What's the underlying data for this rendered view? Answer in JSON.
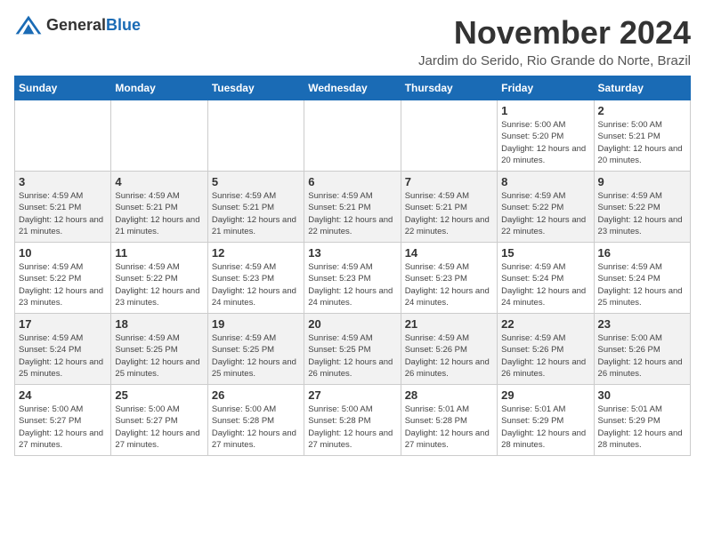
{
  "logo": {
    "general": "General",
    "blue": "Blue"
  },
  "header": {
    "title": "November 2024",
    "subtitle": "Jardim do Serido, Rio Grande do Norte, Brazil"
  },
  "calendar": {
    "weekdays": [
      "Sunday",
      "Monday",
      "Tuesday",
      "Wednesday",
      "Thursday",
      "Friday",
      "Saturday"
    ],
    "weeks": [
      [
        {
          "day": "",
          "info": ""
        },
        {
          "day": "",
          "info": ""
        },
        {
          "day": "",
          "info": ""
        },
        {
          "day": "",
          "info": ""
        },
        {
          "day": "",
          "info": ""
        },
        {
          "day": "1",
          "info": "Sunrise: 5:00 AM\nSunset: 5:20 PM\nDaylight: 12 hours and 20 minutes."
        },
        {
          "day": "2",
          "info": "Sunrise: 5:00 AM\nSunset: 5:21 PM\nDaylight: 12 hours and 20 minutes."
        }
      ],
      [
        {
          "day": "3",
          "info": "Sunrise: 4:59 AM\nSunset: 5:21 PM\nDaylight: 12 hours and 21 minutes."
        },
        {
          "day": "4",
          "info": "Sunrise: 4:59 AM\nSunset: 5:21 PM\nDaylight: 12 hours and 21 minutes."
        },
        {
          "day": "5",
          "info": "Sunrise: 4:59 AM\nSunset: 5:21 PM\nDaylight: 12 hours and 21 minutes."
        },
        {
          "day": "6",
          "info": "Sunrise: 4:59 AM\nSunset: 5:21 PM\nDaylight: 12 hours and 22 minutes."
        },
        {
          "day": "7",
          "info": "Sunrise: 4:59 AM\nSunset: 5:21 PM\nDaylight: 12 hours and 22 minutes."
        },
        {
          "day": "8",
          "info": "Sunrise: 4:59 AM\nSunset: 5:22 PM\nDaylight: 12 hours and 22 minutes."
        },
        {
          "day": "9",
          "info": "Sunrise: 4:59 AM\nSunset: 5:22 PM\nDaylight: 12 hours and 23 minutes."
        }
      ],
      [
        {
          "day": "10",
          "info": "Sunrise: 4:59 AM\nSunset: 5:22 PM\nDaylight: 12 hours and 23 minutes."
        },
        {
          "day": "11",
          "info": "Sunrise: 4:59 AM\nSunset: 5:22 PM\nDaylight: 12 hours and 23 minutes."
        },
        {
          "day": "12",
          "info": "Sunrise: 4:59 AM\nSunset: 5:23 PM\nDaylight: 12 hours and 24 minutes."
        },
        {
          "day": "13",
          "info": "Sunrise: 4:59 AM\nSunset: 5:23 PM\nDaylight: 12 hours and 24 minutes."
        },
        {
          "day": "14",
          "info": "Sunrise: 4:59 AM\nSunset: 5:23 PM\nDaylight: 12 hours and 24 minutes."
        },
        {
          "day": "15",
          "info": "Sunrise: 4:59 AM\nSunset: 5:24 PM\nDaylight: 12 hours and 24 minutes."
        },
        {
          "day": "16",
          "info": "Sunrise: 4:59 AM\nSunset: 5:24 PM\nDaylight: 12 hours and 25 minutes."
        }
      ],
      [
        {
          "day": "17",
          "info": "Sunrise: 4:59 AM\nSunset: 5:24 PM\nDaylight: 12 hours and 25 minutes."
        },
        {
          "day": "18",
          "info": "Sunrise: 4:59 AM\nSunset: 5:25 PM\nDaylight: 12 hours and 25 minutes."
        },
        {
          "day": "19",
          "info": "Sunrise: 4:59 AM\nSunset: 5:25 PM\nDaylight: 12 hours and 25 minutes."
        },
        {
          "day": "20",
          "info": "Sunrise: 4:59 AM\nSunset: 5:25 PM\nDaylight: 12 hours and 26 minutes."
        },
        {
          "day": "21",
          "info": "Sunrise: 4:59 AM\nSunset: 5:26 PM\nDaylight: 12 hours and 26 minutes."
        },
        {
          "day": "22",
          "info": "Sunrise: 4:59 AM\nSunset: 5:26 PM\nDaylight: 12 hours and 26 minutes."
        },
        {
          "day": "23",
          "info": "Sunrise: 5:00 AM\nSunset: 5:26 PM\nDaylight: 12 hours and 26 minutes."
        }
      ],
      [
        {
          "day": "24",
          "info": "Sunrise: 5:00 AM\nSunset: 5:27 PM\nDaylight: 12 hours and 27 minutes."
        },
        {
          "day": "25",
          "info": "Sunrise: 5:00 AM\nSunset: 5:27 PM\nDaylight: 12 hours and 27 minutes."
        },
        {
          "day": "26",
          "info": "Sunrise: 5:00 AM\nSunset: 5:28 PM\nDaylight: 12 hours and 27 minutes."
        },
        {
          "day": "27",
          "info": "Sunrise: 5:00 AM\nSunset: 5:28 PM\nDaylight: 12 hours and 27 minutes."
        },
        {
          "day": "28",
          "info": "Sunrise: 5:01 AM\nSunset: 5:28 PM\nDaylight: 12 hours and 27 minutes."
        },
        {
          "day": "29",
          "info": "Sunrise: 5:01 AM\nSunset: 5:29 PM\nDaylight: 12 hours and 28 minutes."
        },
        {
          "day": "30",
          "info": "Sunrise: 5:01 AM\nSunset: 5:29 PM\nDaylight: 12 hours and 28 minutes."
        }
      ]
    ]
  }
}
